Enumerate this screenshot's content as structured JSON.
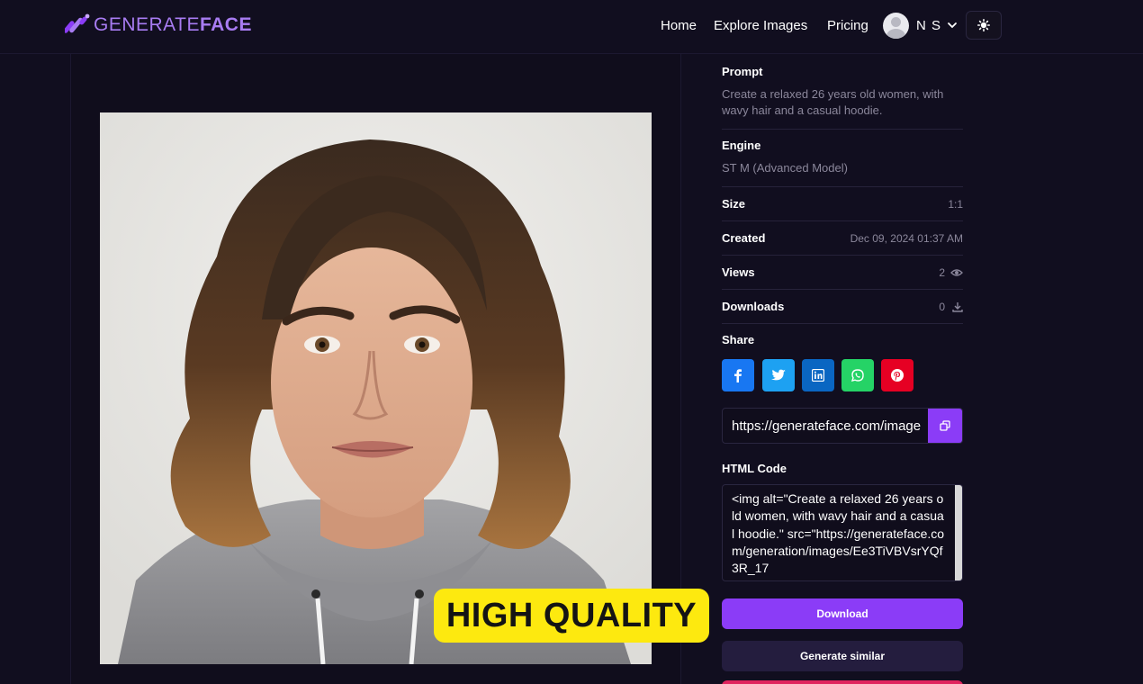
{
  "brand": {
    "name_light": "GENERATE",
    "name_bold": "FACE",
    "accent_color": "#8b3cf7"
  },
  "nav": {
    "home": "Home",
    "explore": "Explore Images",
    "pricing": "Pricing",
    "user_name": "N S"
  },
  "badge": {
    "text": "HIGH QUALITY",
    "color": "#fde90f"
  },
  "details": {
    "prompt_label": "Prompt",
    "prompt_value": "Create a relaxed 26 years old women, with wavy hair and a casual hoodie.",
    "engine_label": "Engine",
    "engine_value": "ST M (Advanced Model)",
    "size_label": "Size",
    "size_value": "1:1",
    "created_label": "Created",
    "created_value": "Dec 09, 2024 01:37 AM",
    "views_label": "Views",
    "views_value": "2",
    "downloads_label": "Downloads",
    "downloads_value": "0"
  },
  "share": {
    "label": "Share",
    "networks": [
      "facebook",
      "twitter",
      "linkedin",
      "whatsapp",
      "pinterest"
    ],
    "url_value": "https://generateface.com/image"
  },
  "html_code": {
    "label": "HTML Code",
    "value": "<img alt=\"Create a relaxed 26 years old women, with wavy hair and a casual hoodie.\" src=\"https://generateface.com/generation/images/Ee3TiVBVsrYQf3R_17"
  },
  "actions": {
    "download": "Download",
    "generate_similar": "Generate similar"
  }
}
